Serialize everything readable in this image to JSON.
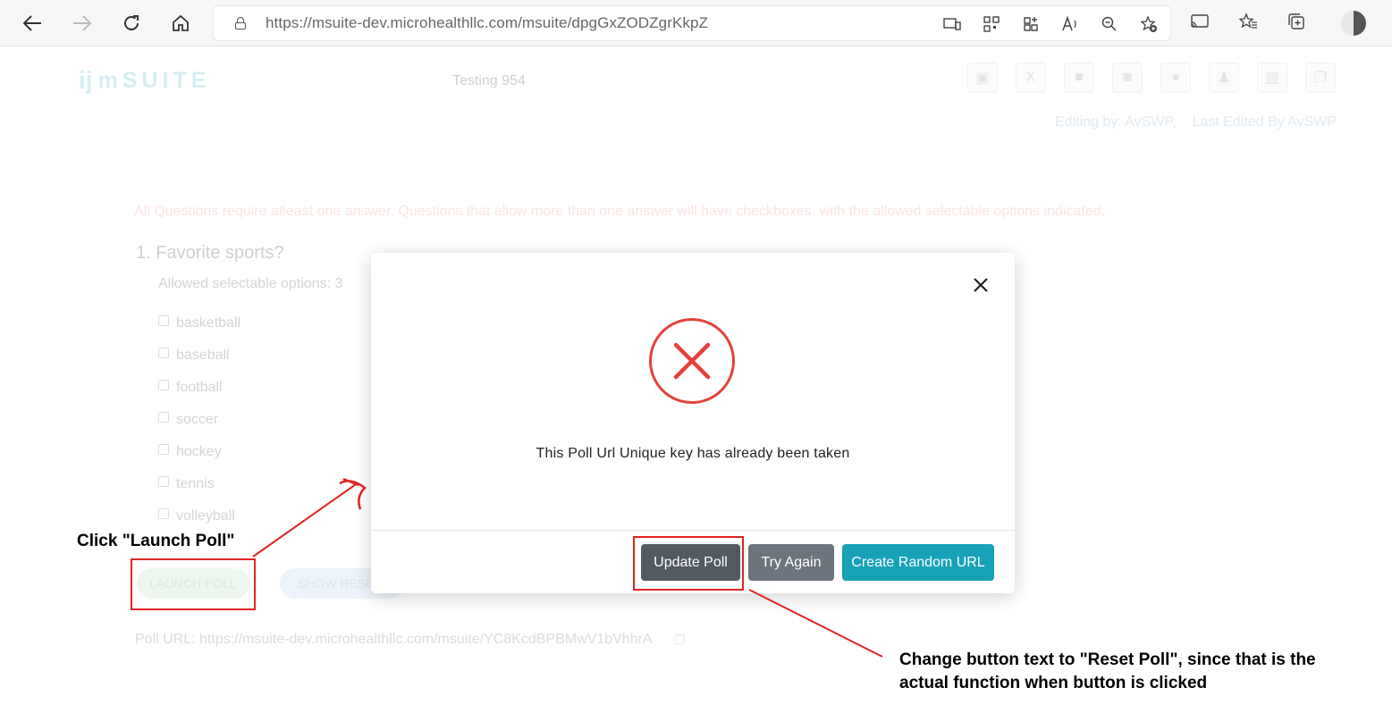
{
  "browser": {
    "url_host": "https://msuite-dev.microhealthllc.com",
    "url_path": "/msuite/dpgGxZODZgrKkpZ"
  },
  "app": {
    "logo_text": "mSUITE",
    "doc_title": "Testing 954",
    "editing_by": "Editing by: AvSWP,",
    "last_edited": "Last Edited By AvSWP",
    "notice": "All Questions require atleast one answer. Questions that allow more than one answer will have checkboxes, with the allowed selectable options indicated.",
    "question": "1. Favorite sports?",
    "allowed": "Allowed selectable options: 3",
    "options": [
      "basketball",
      "baseball",
      "football",
      "soccer",
      "hockey",
      "tennis",
      "volleyball"
    ],
    "launch_label": "LAUNCH POLL",
    "show_label": "SHOW RESU",
    "poll_url": "Poll URL: https://msuite-dev.microhealthllc.com/msuite/YC8KcdBPBMwV1bVhhrA"
  },
  "modal": {
    "message": "This Poll Url Unique key has already been taken",
    "update_label": "Update Poll",
    "try_label": "Try Again",
    "random_label": "Create Random URL",
    "error_color": "#e4413a"
  },
  "annotations": {
    "click_launch": "Click \"Launch Poll\"",
    "change_text_line1": "Change button text to \"Reset Poll\", since that is the",
    "change_text_line2": "actual function when button is clicked",
    "color": "#e02424"
  }
}
